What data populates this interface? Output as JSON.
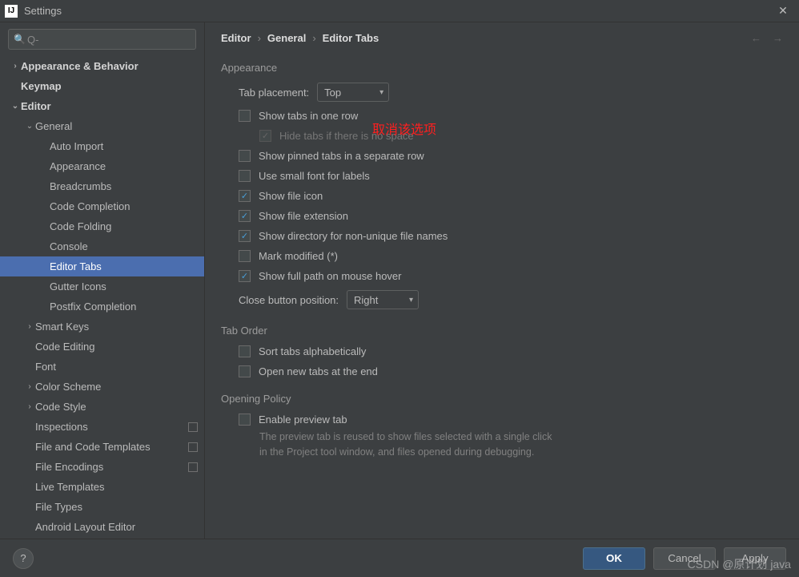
{
  "window": {
    "title": "Settings",
    "app_icon_text": "IJ"
  },
  "search": {
    "placeholder": "Q-"
  },
  "breadcrumb": [
    "Editor",
    "General",
    "Editor Tabs"
  ],
  "annotation": "取消该选项",
  "watermark": "CSDN @原计划 java",
  "tree": [
    {
      "label": "Appearance & Behavior",
      "depth": 0,
      "arrow": ">",
      "bold": true
    },
    {
      "label": "Keymap",
      "depth": 0,
      "arrow": "",
      "bold": true
    },
    {
      "label": "Editor",
      "depth": 0,
      "arrow": "v",
      "bold": true
    },
    {
      "label": "General",
      "depth": 1,
      "arrow": "v",
      "bold": false
    },
    {
      "label": "Auto Import",
      "depth": 2,
      "arrow": ""
    },
    {
      "label": "Appearance",
      "depth": 2,
      "arrow": ""
    },
    {
      "label": "Breadcrumbs",
      "depth": 2,
      "arrow": ""
    },
    {
      "label": "Code Completion",
      "depth": 2,
      "arrow": ""
    },
    {
      "label": "Code Folding",
      "depth": 2,
      "arrow": ""
    },
    {
      "label": "Console",
      "depth": 2,
      "arrow": ""
    },
    {
      "label": "Editor Tabs",
      "depth": 2,
      "arrow": "",
      "selected": true
    },
    {
      "label": "Gutter Icons",
      "depth": 2,
      "arrow": ""
    },
    {
      "label": "Postfix Completion",
      "depth": 2,
      "arrow": ""
    },
    {
      "label": "Smart Keys",
      "depth": 1,
      "arrow": ">"
    },
    {
      "label": "Code Editing",
      "depth": 1,
      "arrow": ""
    },
    {
      "label": "Font",
      "depth": 1,
      "arrow": ""
    },
    {
      "label": "Color Scheme",
      "depth": 1,
      "arrow": ">"
    },
    {
      "label": "Code Style",
      "depth": 1,
      "arrow": ">"
    },
    {
      "label": "Inspections",
      "depth": 1,
      "arrow": "",
      "badge": true
    },
    {
      "label": "File and Code Templates",
      "depth": 1,
      "arrow": "",
      "badge": true
    },
    {
      "label": "File Encodings",
      "depth": 1,
      "arrow": "",
      "badge": true
    },
    {
      "label": "Live Templates",
      "depth": 1,
      "arrow": ""
    },
    {
      "label": "File Types",
      "depth": 1,
      "arrow": ""
    },
    {
      "label": "Android Layout Editor",
      "depth": 1,
      "arrow": ""
    }
  ],
  "sections": {
    "appearance": {
      "title": "Appearance",
      "tab_placement_label": "Tab placement:",
      "tab_placement_value": "Top",
      "rows": [
        {
          "key": "one_row",
          "label": "Show tabs in one row",
          "checked": false
        },
        {
          "key": "hide_no_space",
          "label": "Hide tabs if there is no space",
          "checked": true,
          "disabled": true,
          "sub": true
        },
        {
          "key": "pinned_separate",
          "label": "Show pinned tabs in a separate row",
          "checked": false
        },
        {
          "key": "small_font",
          "label": "Use small font for labels",
          "checked": false
        },
        {
          "key": "file_icon",
          "label": "Show file icon",
          "checked": true
        },
        {
          "key": "file_ext",
          "label": "Show file extension",
          "checked": true
        },
        {
          "key": "dir_nonunique",
          "label": "Show directory for non-unique file names",
          "checked": true
        },
        {
          "key": "mark_modified",
          "label": "Mark modified (*)",
          "checked": false
        },
        {
          "key": "full_path_hover",
          "label": "Show full path on mouse hover",
          "checked": true
        }
      ],
      "close_button_label": "Close button position:",
      "close_button_value": "Right"
    },
    "tab_order": {
      "title": "Tab Order",
      "rows": [
        {
          "key": "sort_alpha",
          "label": "Sort tabs alphabetically",
          "checked": false
        },
        {
          "key": "open_end",
          "label": "Open new tabs at the end",
          "checked": false
        }
      ]
    },
    "opening": {
      "title": "Opening Policy",
      "rows": [
        {
          "key": "preview_tab",
          "label": "Enable preview tab",
          "checked": false
        }
      ],
      "desc1": "The preview tab is reused to show files selected with a single click",
      "desc2": "in the Project tool window, and files opened during debugging."
    }
  },
  "buttons": {
    "ok": "OK",
    "cancel": "Cancel",
    "apply": "Apply",
    "help": "?"
  },
  "nav": {
    "back": "←",
    "forward": "→"
  }
}
